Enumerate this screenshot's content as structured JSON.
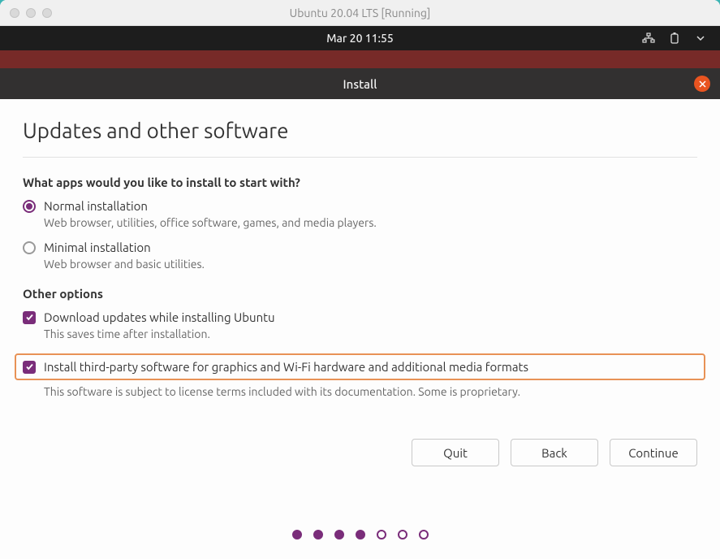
{
  "vm": {
    "title": "Ubuntu 20.04 LTS [Running]"
  },
  "topbar": {
    "datetime": "Mar 20  11:55"
  },
  "installer": {
    "window_title": "Install",
    "heading": "Updates and other software",
    "apps_question": "What apps would you like to install to start with?",
    "normal": {
      "label": "Normal installation",
      "desc": "Web browser, utilities, office software, games, and media players."
    },
    "minimal": {
      "label": "Minimal installation",
      "desc": "Web browser and basic utilities."
    },
    "other_options": "Other options",
    "download_updates": {
      "label": "Download updates while installing Ubuntu",
      "desc": "This saves time after installation."
    },
    "third_party": {
      "label": "Install third-party software for graphics and Wi-Fi hardware and additional media formats",
      "desc": "This software is subject to license terms included with its documentation. Some is proprietary."
    },
    "buttons": {
      "quit": "Quit",
      "back": "Back",
      "continue": "Continue"
    }
  }
}
